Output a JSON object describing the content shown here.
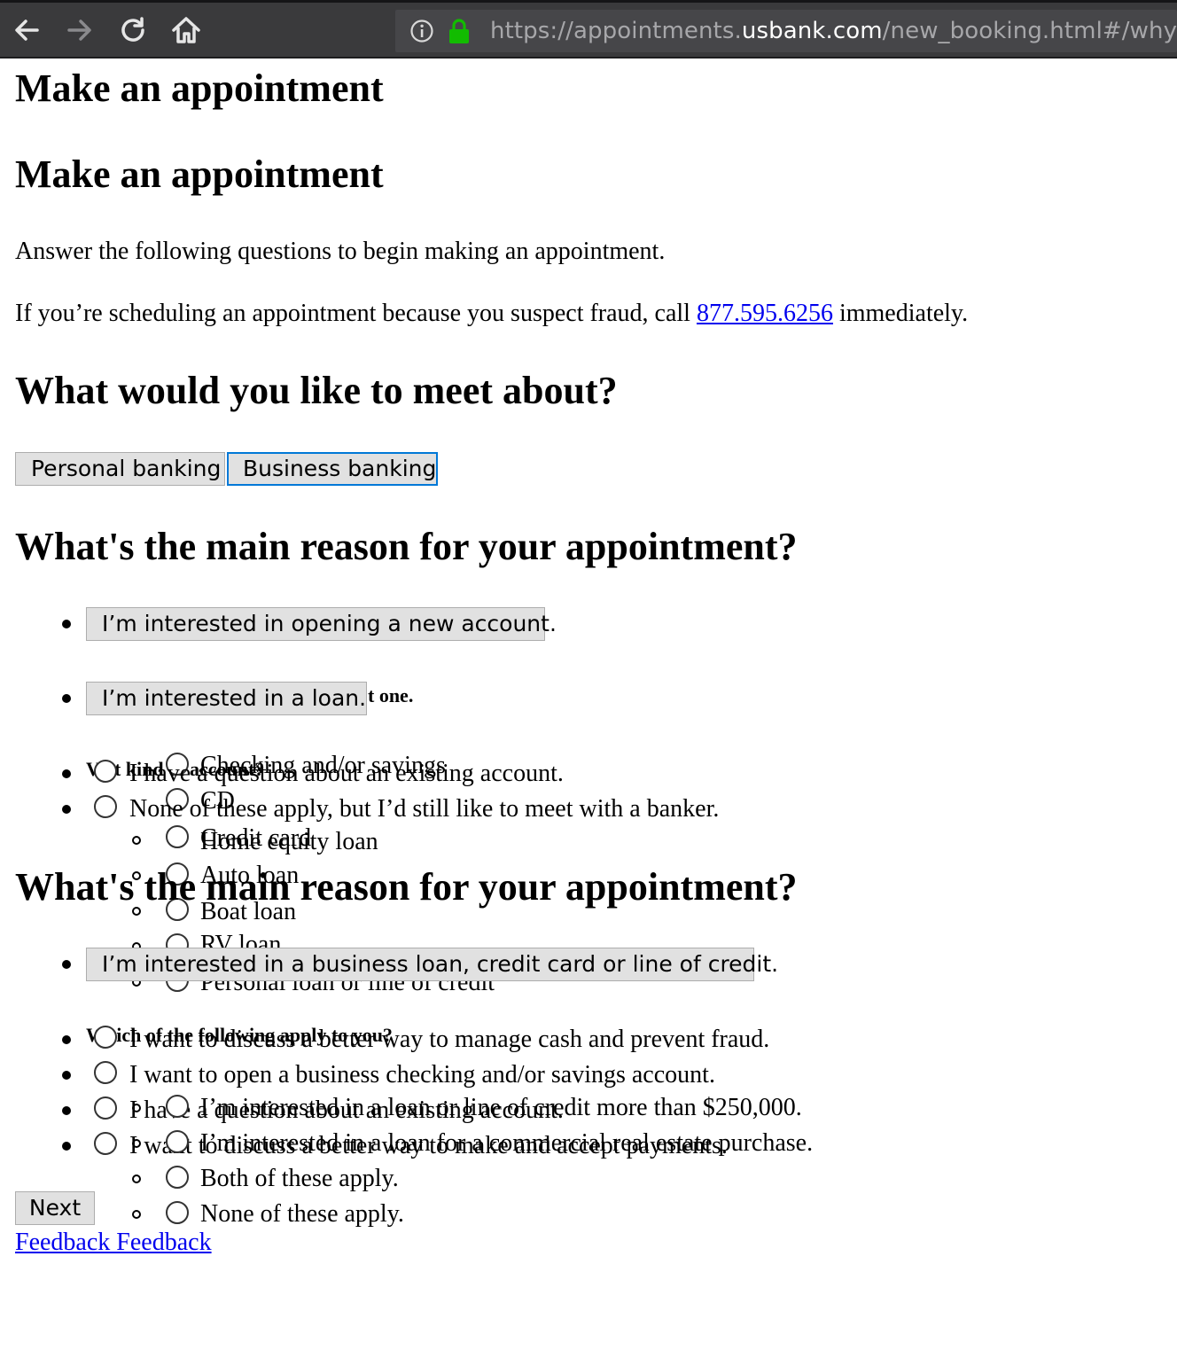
{
  "browser": {
    "url_prefix": "https://appointments.",
    "url_domain": "usbank.com",
    "url_suffix": "/new_booking.html#/why"
  },
  "page": {
    "title": "Make an appointment",
    "heading": "Make an appointment",
    "intro": "Answer the following questions to begin making an appointment.",
    "fraud_before": "If you’re scheduling an appointment because you suspect fraud, call",
    "fraud_phone": "877.595.6256",
    "fraud_after": "immediately."
  },
  "meet_about": {
    "heading": "What would you like to meet about?",
    "buttons": [
      "Personal banking",
      "Business banking"
    ]
  },
  "personal_reason": {
    "heading": "What's the main reason for your appointment?",
    "button_options": [
      "I’m interested in opening a new account.",
      "I’m interested in a loan."
    ],
    "radio_options": [
      "I have a question about an existing account.",
      "None of these apply, but I’d still like to meet with a banker."
    ],
    "select_one_tail": "t one.",
    "account_question_fragment": "V  at kind of account?",
    "account_types": [
      "Checking and/or savings",
      "CD"
    ],
    "loan_types": [
      "Credit card",
      "Home equity loan",
      "Auto loan",
      "Boat loan",
      "RV loan",
      "Personal loan or line of credit"
    ]
  },
  "business_reason": {
    "heading": "What's the main reason for your appointment?",
    "button_option": "I’m interested in a business loan, credit card or line of credit.",
    "question": "Which of the following apply to you?",
    "radio_options": [
      "I want to discuss a better way to manage cash and prevent fraud.",
      "I want to open a business checking and/or savings account.",
      "I have a question about an existing account.",
      "I want to discuss a better way to make and accept payments."
    ],
    "loan_apply_options": [
      "I’m interested in a loan or line of credit more than $250,000.",
      "I’m interested in a loan for a commercial real estate purchase.",
      "Both of these apply.",
      "None of these apply."
    ]
  },
  "footer": {
    "next_label": "Next",
    "feedback_label": "Feedback Feedback"
  }
}
